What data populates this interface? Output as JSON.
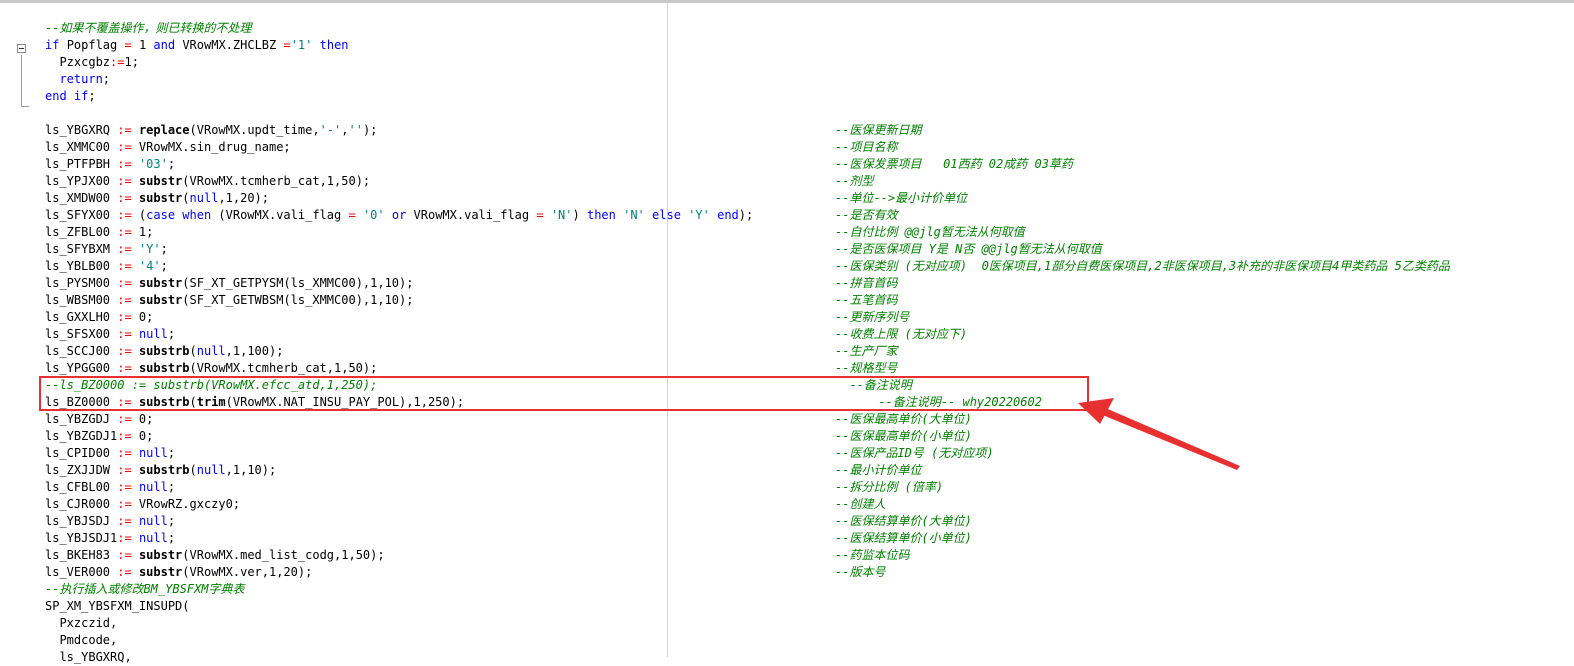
{
  "code": {
    "lines": [
      [
        {
          "t": "--如果不覆盖操作，则已转换的不处理",
          "c": "cmt"
        }
      ],
      [
        {
          "t": "if ",
          "c": "kw"
        },
        {
          "t": "Popflag ",
          "c": ""
        },
        {
          "t": "=",
          "c": "op"
        },
        {
          "t": " 1 ",
          "c": ""
        },
        {
          "t": "and",
          "c": "kw"
        },
        {
          "t": " VRowMX.ZHCLBZ ",
          "c": ""
        },
        {
          "t": "=",
          "c": "op"
        },
        {
          "t": "'1'",
          "c": "str"
        },
        {
          "t": " then",
          "c": "kw"
        }
      ],
      [
        {
          "t": "  Pzxcgbz",
          "c": ""
        },
        {
          "t": ":=",
          "c": "op"
        },
        {
          "t": "1;",
          "c": ""
        }
      ],
      [
        {
          "t": "  return",
          "c": "kw"
        },
        {
          "t": ";",
          "c": ""
        }
      ],
      [
        {
          "t": "end if",
          "c": "kw"
        },
        {
          "t": ";",
          "c": ""
        }
      ],
      [
        {
          "t": "",
          "c": ""
        }
      ],
      [
        {
          "t": "ls_YBGXRQ ",
          "c": ""
        },
        {
          "t": ":=",
          "c": "op"
        },
        {
          "t": " ",
          "c": ""
        },
        {
          "t": "replace",
          "c": "fn"
        },
        {
          "t": "(VRowMX.updt_time,",
          "c": ""
        },
        {
          "t": "'-'",
          "c": "str"
        },
        {
          "t": ",",
          "c": ""
        },
        {
          "t": "''",
          "c": "str"
        },
        {
          "t": ");",
          "c": ""
        }
      ],
      [
        {
          "t": "ls_XMMC00 ",
          "c": ""
        },
        {
          "t": ":=",
          "c": "op"
        },
        {
          "t": " VRowMX.sin_drug_name;",
          "c": ""
        }
      ],
      [
        {
          "t": "ls_PTFPBH ",
          "c": ""
        },
        {
          "t": ":=",
          "c": "op"
        },
        {
          "t": " ",
          "c": ""
        },
        {
          "t": "'03'",
          "c": "str"
        },
        {
          "t": ";",
          "c": ""
        }
      ],
      [
        {
          "t": "ls_YPJX00 ",
          "c": ""
        },
        {
          "t": ":=",
          "c": "op"
        },
        {
          "t": " ",
          "c": ""
        },
        {
          "t": "substr",
          "c": "fn"
        },
        {
          "t": "(VRowMX.tcmherb_cat,1,50);",
          "c": ""
        }
      ],
      [
        {
          "t": "ls_XMDW00 ",
          "c": ""
        },
        {
          "t": ":=",
          "c": "op"
        },
        {
          "t": " ",
          "c": ""
        },
        {
          "t": "substr",
          "c": "fn"
        },
        {
          "t": "(",
          "c": ""
        },
        {
          "t": "null",
          "c": "kw"
        },
        {
          "t": ",1,20);",
          "c": ""
        }
      ],
      [
        {
          "t": "ls_SFYX00 ",
          "c": ""
        },
        {
          "t": ":=",
          "c": "op"
        },
        {
          "t": " (",
          "c": ""
        },
        {
          "t": "case when",
          "c": "kw"
        },
        {
          "t": " (VRowMX.vali_flag ",
          "c": ""
        },
        {
          "t": "=",
          "c": "op"
        },
        {
          "t": " ",
          "c": ""
        },
        {
          "t": "'0'",
          "c": "str"
        },
        {
          "t": " ",
          "c": ""
        },
        {
          "t": "or",
          "c": "kw"
        },
        {
          "t": " VRowMX.vali_flag ",
          "c": ""
        },
        {
          "t": "=",
          "c": "op"
        },
        {
          "t": " ",
          "c": ""
        },
        {
          "t": "'N'",
          "c": "str"
        },
        {
          "t": ") ",
          "c": ""
        },
        {
          "t": "then",
          "c": "kw"
        },
        {
          "t": " ",
          "c": ""
        },
        {
          "t": "'N'",
          "c": "str"
        },
        {
          "t": " ",
          "c": ""
        },
        {
          "t": "else",
          "c": "kw"
        },
        {
          "t": " ",
          "c": ""
        },
        {
          "t": "'Y'",
          "c": "str"
        },
        {
          "t": " ",
          "c": ""
        },
        {
          "t": "end",
          "c": "kw"
        },
        {
          "t": ");",
          "c": ""
        }
      ],
      [
        {
          "t": "ls_ZFBL00 ",
          "c": ""
        },
        {
          "t": ":=",
          "c": "op"
        },
        {
          "t": " 1;",
          "c": ""
        }
      ],
      [
        {
          "t": "ls_SFYBXM ",
          "c": ""
        },
        {
          "t": ":=",
          "c": "op"
        },
        {
          "t": " ",
          "c": ""
        },
        {
          "t": "'Y'",
          "c": "str"
        },
        {
          "t": ";",
          "c": ""
        }
      ],
      [
        {
          "t": "ls_YBLB00 ",
          "c": ""
        },
        {
          "t": ":=",
          "c": "op"
        },
        {
          "t": " ",
          "c": ""
        },
        {
          "t": "'4'",
          "c": "str"
        },
        {
          "t": ";",
          "c": ""
        }
      ],
      [
        {
          "t": "ls_PYSM00 ",
          "c": ""
        },
        {
          "t": ":=",
          "c": "op"
        },
        {
          "t": " ",
          "c": ""
        },
        {
          "t": "substr",
          "c": "fn"
        },
        {
          "t": "(SF_XT_GETPYSM(ls_XMMC00),1,10);",
          "c": ""
        }
      ],
      [
        {
          "t": "ls_WBSM00 ",
          "c": ""
        },
        {
          "t": ":=",
          "c": "op"
        },
        {
          "t": " ",
          "c": ""
        },
        {
          "t": "substr",
          "c": "fn"
        },
        {
          "t": "(SF_XT_GETWBSM(ls_XMMC00),1,10);",
          "c": ""
        }
      ],
      [
        {
          "t": "ls_GXXLH0 ",
          "c": ""
        },
        {
          "t": ":=",
          "c": "op"
        },
        {
          "t": " 0;",
          "c": ""
        }
      ],
      [
        {
          "t": "ls_SFSX00 ",
          "c": ""
        },
        {
          "t": ":=",
          "c": "op"
        },
        {
          "t": " ",
          "c": ""
        },
        {
          "t": "null",
          "c": "kw"
        },
        {
          "t": ";",
          "c": ""
        }
      ],
      [
        {
          "t": "ls_SCCJ00 ",
          "c": ""
        },
        {
          "t": ":=",
          "c": "op"
        },
        {
          "t": " ",
          "c": ""
        },
        {
          "t": "substrb",
          "c": "fn"
        },
        {
          "t": "(",
          "c": ""
        },
        {
          "t": "null",
          "c": "kw"
        },
        {
          "t": ",1,100);",
          "c": ""
        }
      ],
      [
        {
          "t": "ls_YPGG00 ",
          "c": ""
        },
        {
          "t": ":=",
          "c": "op"
        },
        {
          "t": " ",
          "c": ""
        },
        {
          "t": "substrb",
          "c": "fn"
        },
        {
          "t": "(VRowMX.tcmherb_cat,1,50);",
          "c": ""
        }
      ],
      [
        {
          "t": "--ls_BZ0000 := substrb(VRowMX.efcc_atd,1,250);",
          "c": "cmt"
        }
      ],
      [
        {
          "t": "ls_BZ0000 ",
          "c": ""
        },
        {
          "t": ":=",
          "c": "op"
        },
        {
          "t": " ",
          "c": ""
        },
        {
          "t": "substrb",
          "c": "fn"
        },
        {
          "t": "(",
          "c": ""
        },
        {
          "t": "trim",
          "c": "fn"
        },
        {
          "t": "(VRowMX.NAT_INSU_PAY_POL),1,250);",
          "c": ""
        }
      ],
      [
        {
          "t": "ls_YBZGDJ ",
          "c": ""
        },
        {
          "t": ":=",
          "c": "op"
        },
        {
          "t": " 0;",
          "c": ""
        }
      ],
      [
        {
          "t": "ls_YBZGDJ1",
          "c": ""
        },
        {
          "t": ":=",
          "c": "op"
        },
        {
          "t": " 0;",
          "c": ""
        }
      ],
      [
        {
          "t": "ls_CPID00 ",
          "c": ""
        },
        {
          "t": ":=",
          "c": "op"
        },
        {
          "t": " ",
          "c": ""
        },
        {
          "t": "null",
          "c": "kw"
        },
        {
          "t": ";",
          "c": ""
        }
      ],
      [
        {
          "t": "ls_ZXJJDW ",
          "c": ""
        },
        {
          "t": ":=",
          "c": "op"
        },
        {
          "t": " ",
          "c": ""
        },
        {
          "t": "substrb",
          "c": "fn"
        },
        {
          "t": "(",
          "c": ""
        },
        {
          "t": "null",
          "c": "kw"
        },
        {
          "t": ",1,10);",
          "c": ""
        }
      ],
      [
        {
          "t": "ls_CFBL00 ",
          "c": ""
        },
        {
          "t": ":=",
          "c": "op"
        },
        {
          "t": " ",
          "c": ""
        },
        {
          "t": "null",
          "c": "kw"
        },
        {
          "t": ";",
          "c": ""
        }
      ],
      [
        {
          "t": "ls_CJR000 ",
          "c": ""
        },
        {
          "t": ":=",
          "c": "op"
        },
        {
          "t": " VRowRZ.gxczy0;",
          "c": ""
        }
      ],
      [
        {
          "t": "ls_YBJSDJ ",
          "c": ""
        },
        {
          "t": ":=",
          "c": "op"
        },
        {
          "t": " ",
          "c": ""
        },
        {
          "t": "null",
          "c": "kw"
        },
        {
          "t": ";",
          "c": ""
        }
      ],
      [
        {
          "t": "ls_YBJSDJ1",
          "c": ""
        },
        {
          "t": ":=",
          "c": "op"
        },
        {
          "t": " ",
          "c": ""
        },
        {
          "t": "null",
          "c": "kw"
        },
        {
          "t": ";",
          "c": ""
        }
      ],
      [
        {
          "t": "ls_BKEH83 ",
          "c": ""
        },
        {
          "t": ":=",
          "c": "op"
        },
        {
          "t": " ",
          "c": ""
        },
        {
          "t": "substr",
          "c": "fn"
        },
        {
          "t": "(VRowMX.med_list_codg,1,50);",
          "c": ""
        }
      ],
      [
        {
          "t": "ls_VER000 ",
          "c": ""
        },
        {
          "t": ":=",
          "c": "op"
        },
        {
          "t": " ",
          "c": ""
        },
        {
          "t": "substr",
          "c": "fn"
        },
        {
          "t": "(VRowMX.ver,1,20);",
          "c": ""
        }
      ],
      [
        {
          "t": "--执行插入或修改BM_YBSFXM字典表",
          "c": "cmt"
        }
      ],
      [
        {
          "t": "SP_XM_YBSFXM_INSUPD(",
          "c": ""
        }
      ],
      [
        {
          "t": "  Pxzczid,",
          "c": ""
        }
      ],
      [
        {
          "t": "  Pmdcode,",
          "c": ""
        }
      ],
      [
        {
          "t": "  ls_YBGXRQ,",
          "c": ""
        }
      ]
    ]
  },
  "comments": [
    "--医保更新日期",
    "--项目名称",
    "--医保发票项目   01西药 02成药 03草药",
    "--剂型",
    "--单位-->最小计价单位",
    "--是否有效",
    "--自付比例 @@jlg暂无法从何取值",
    "--是否医保项目 Y是 N否 @@jlg暂无法从何取值",
    "--医保类别 (无对应项)  0医保项目,1部分自费医保项目,2非医保项目,3补充的非医保项目4甲类药品 5乙类药品",
    "--拼音首码",
    "--五笔首码",
    "--更新序列号",
    "--收费上限 (无对应下)",
    "--生产厂家",
    "--规格型号",
    "  --备注说明",
    "      --备注说明-- why20220602",
    "--医保最高单价(大单位)",
    "--医保最高单价(小单位)",
    "--医保产品ID号 (无对应项)",
    "--最小计价单位",
    "--拆分比例 (倍率)",
    "--创建人",
    "--医保结算单价(大单位)",
    "--医保结算单价(小单位)",
    "--药监本位码",
    "--版本号"
  ],
  "colors": {
    "highlight": "#e83030",
    "comment": "#008000",
    "keyword": "#0000ff",
    "string": "#008080"
  }
}
